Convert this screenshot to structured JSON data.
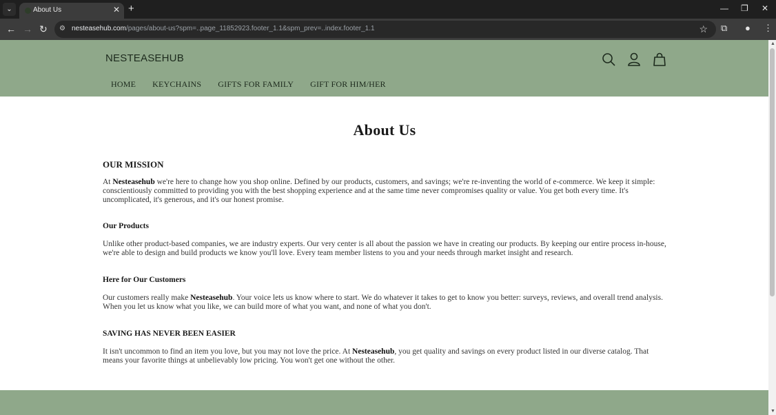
{
  "browser": {
    "tab_title": "About Us",
    "url_host": "nesteasehub.com",
    "url_path": "/pages/about-us?spm=..page_11852923.footer_1.1&spm_prev=..index.footer_1.1"
  },
  "site": {
    "logo": "NESTEASEHUB",
    "nav": [
      "HOME",
      "KEYCHAINS",
      "GIFTS FOR FAMILY",
      "GIFT FOR HIM/HER"
    ],
    "header_icons": [
      "search-icon",
      "account-icon",
      "cart-icon"
    ],
    "brand_color": "#8fa88a"
  },
  "page": {
    "title": "About Us",
    "sections": [
      {
        "heading": "OUR MISSION",
        "pre": "At ",
        "bold": "Nesteasehub",
        "post": " we're here to change how you shop online. Defined by our products, customers, and savings; we're re-inventing the world of e-commerce. We keep it simple: conscientiously committed to providing you with the best shopping experience and at the same time never compromises quality or value. You get both every time. It's uncomplicated, it's generous, and it's our honest promise."
      },
      {
        "heading": "Our Products",
        "text": "Unlike other product-based companies, we are industry experts. Our very center is all about the passion we have in creating our products. By keeping our entire process in-house, we're able to design and build products we know you'll love. Every team member listens to you and your needs through market insight and research."
      },
      {
        "heading": "Here for Our Customers",
        "pre": "Our customers really make ",
        "bold": "Nesteasehub",
        "post": ". Your voice lets us know where to start. We do whatever it takes to get to know you better: surveys, reviews, and overall trend analysis. When you let us know what you like, we can build more of what you want, and none of what you don't."
      },
      {
        "heading": "SAVING HAS NEVER BEEN EASIER",
        "pre": "It isn't uncommon to find an item you love, but you may not love the price. At ",
        "bold": "Nesteasehub",
        "post": ", you get quality and savings on every product listed in our diverse catalog. That means your favorite things at unbelievably low pricing. You won't get one without the other."
      }
    ]
  }
}
